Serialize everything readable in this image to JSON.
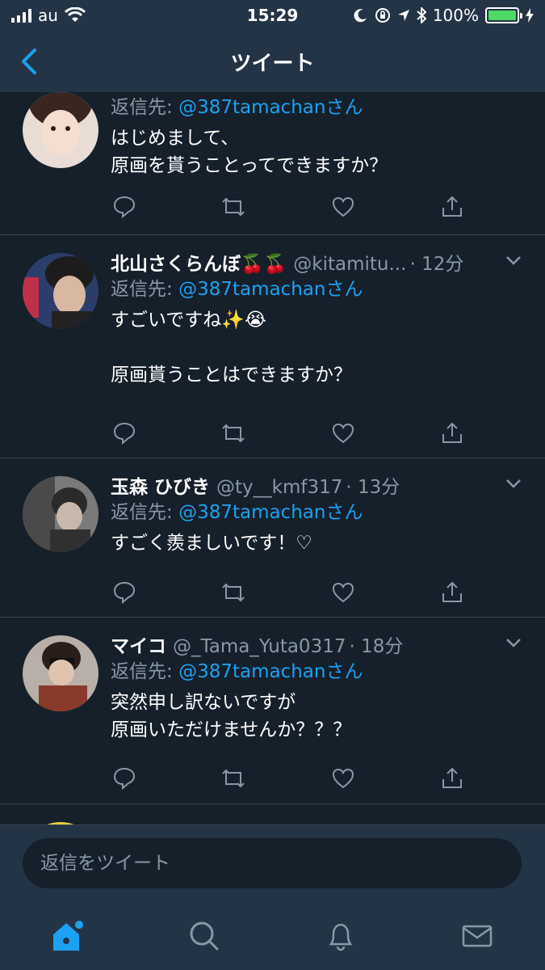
{
  "status_bar": {
    "carrier": "au",
    "time": "15:29",
    "battery": "100%",
    "battery_level": 1.0
  },
  "nav": {
    "title": "ツイート",
    "back_icon": "chevron-left-icon"
  },
  "tweets": [
    {
      "name": "",
      "handle": "",
      "time": "",
      "reply_prefix": "返信先: ",
      "reply_to": "@387tamachanさん",
      "text": "はじめまして、\n原画を貰うことってできますか？"
    },
    {
      "name": "北山さくらんぼ🍒🍒",
      "handle": "@kitamitu...",
      "time": "· 12分",
      "reply_prefix": "返信先: ",
      "reply_to": "@387tamachanさん",
      "text": "すごいですね✨😭\n\n原画貰うことはできますか？"
    },
    {
      "name": "玉森 ひびき",
      "handle": "@ty__kmf317",
      "time": "· 13分",
      "reply_prefix": "返信先: ",
      "reply_to": "@387tamachanさん",
      "text": "すごく羨ましいです！♡"
    },
    {
      "name": "マイコ",
      "handle": "@_Tama_Yuta0317",
      "time": "· 18分",
      "reply_prefix": "返信先: ",
      "reply_to": "@387tamachanさん",
      "text": "突然申し訳ないですが\n原画いただけませんか？？？"
    }
  ],
  "reply_bar": {
    "placeholder": "返信をツイート"
  },
  "tabs": [
    {
      "icon": "home-icon",
      "active": true
    },
    {
      "icon": "search-icon",
      "active": false
    },
    {
      "icon": "bell-icon",
      "active": false
    },
    {
      "icon": "mail-icon",
      "active": false
    }
  ],
  "colors": {
    "background": "#15202b",
    "bar": "#243447",
    "accent": "#1da1f2",
    "muted": "#8899a6",
    "divider": "#38444d"
  }
}
